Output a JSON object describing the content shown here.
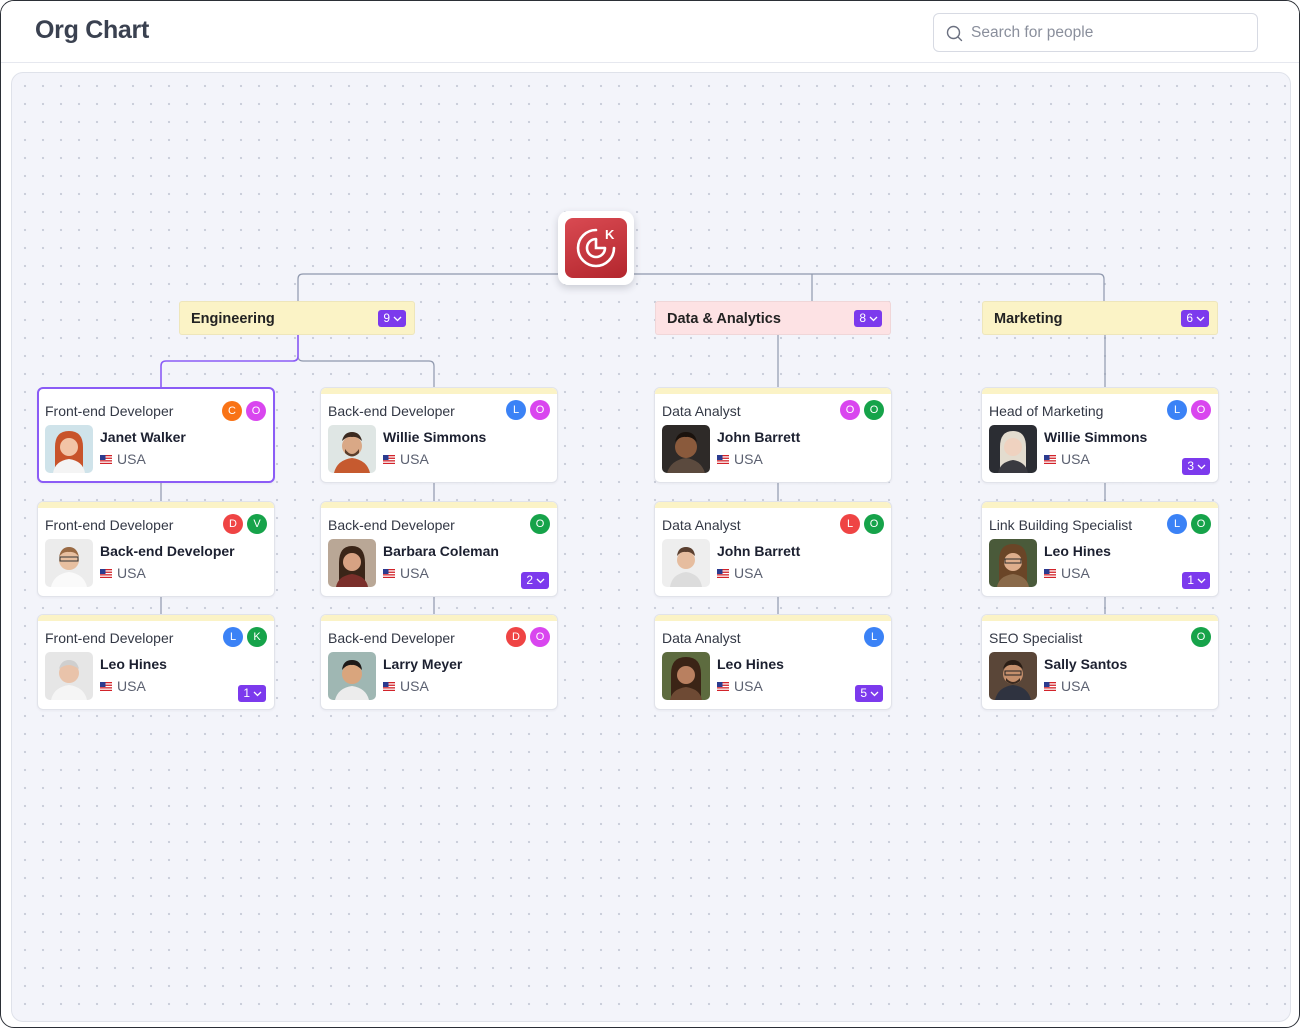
{
  "header": {
    "title": "Org Chart"
  },
  "search": {
    "placeholder": "Search for people",
    "icon": "search-icon"
  },
  "colors": {
    "accent": "#7c3aed",
    "engineering": "#fbf3c6",
    "data_analytics": "#fde2e4",
    "marketing": "#fbf3c6",
    "selected_border": "#8b5cf6"
  },
  "root": {
    "logo": "company-logo-icon",
    "letter": "K"
  },
  "departments": [
    {
      "label": "Engineering",
      "count": "9"
    },
    {
      "label": "Data & Analytics",
      "count": "8"
    },
    {
      "label": "Marketing",
      "count": "6"
    }
  ],
  "cards": [
    {
      "role": "Front-end Developer",
      "name": "Janet Walker",
      "location": "USA",
      "avatars": [
        "C",
        "O"
      ],
      "count": ""
    },
    {
      "role": "Front-end Developer",
      "name": "Back-end Developer",
      "location": "USA",
      "avatars": [
        "D",
        "V"
      ],
      "count": ""
    },
    {
      "role": "Front-end Developer",
      "name": "Leo Hines",
      "location": "USA",
      "avatars": [
        "L",
        "K"
      ],
      "count": "1"
    },
    {
      "role": "Back-end Developer",
      "name": "Willie Simmons",
      "location": "USA",
      "avatars": [
        "L",
        "O"
      ],
      "count": ""
    },
    {
      "role": "Back-end Developer",
      "name": "Barbara Coleman",
      "location": "USA",
      "avatars": [
        "O"
      ],
      "count": "2"
    },
    {
      "role": "Back-end Developer",
      "name": "Larry Meyer",
      "location": "USA",
      "avatars": [
        "D",
        "O"
      ],
      "count": ""
    },
    {
      "role": "Data Analyst",
      "name": "John Barrett",
      "location": "USA",
      "avatars": [
        "O",
        "O"
      ],
      "count": ""
    },
    {
      "role": "Data Analyst",
      "name": "John Barrett",
      "location": "USA",
      "avatars": [
        "L",
        "O"
      ],
      "count": ""
    },
    {
      "role": "Data Analyst",
      "name": "Leo Hines",
      "location": "USA",
      "avatars": [
        "L"
      ],
      "count": "5"
    },
    {
      "role": "Head of Marketing",
      "name": "Willie Simmons",
      "location": "USA",
      "avatars": [
        "L",
        "O"
      ],
      "count": "3"
    },
    {
      "role": "Link Building Specialist",
      "name": "Leo Hines",
      "location": "USA",
      "avatars": [
        "L",
        "O"
      ],
      "count": "1"
    },
    {
      "role": "SEO Specialist",
      "name": "Sally Santos",
      "location": "USA",
      "avatars": [
        "O"
      ],
      "count": ""
    }
  ]
}
